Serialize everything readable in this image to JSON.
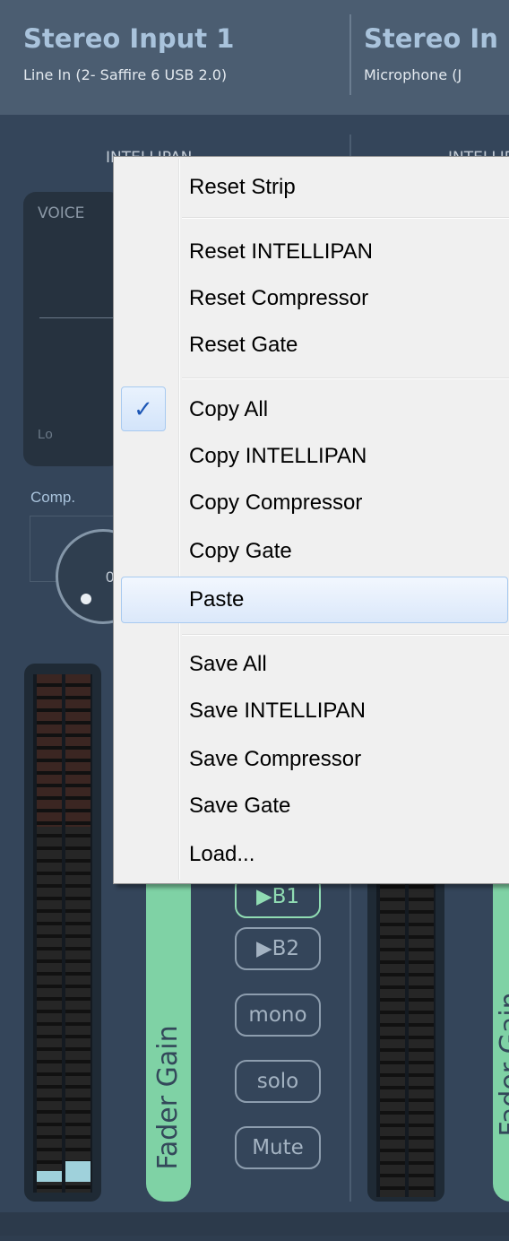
{
  "strips": [
    {
      "title": "Stereo Input 1",
      "subtitle": "Line In (2- Saffire 6 USB 2.0)"
    },
    {
      "title": "Stereo In",
      "subtitle": "Microphone (J"
    }
  ],
  "sections": {
    "intellipan_label": "INTELLIPAN",
    "voice_label": "VOICE",
    "lo_label": "Lo",
    "comp_label": "Comp.",
    "knob_value": "0"
  },
  "fader": {
    "label": "Fader Gain",
    "label2": "Fader Gain"
  },
  "strip_buttons": {
    "b1": "▶B1",
    "b2": "▶B2",
    "mono": "mono",
    "solo": "solo",
    "mute": "Mute"
  },
  "meter": {
    "level_left": 0.02,
    "level_right": 0.04
  },
  "context_menu": {
    "items": [
      {
        "label": "Reset Strip"
      },
      {
        "label": "Reset INTELLIPAN"
      },
      {
        "label": "Reset Compressor"
      },
      {
        "label": "Reset Gate"
      },
      {
        "label": "Copy All",
        "checked": true
      },
      {
        "label": "Copy INTELLIPAN"
      },
      {
        "label": "Copy Compressor"
      },
      {
        "label": "Copy Gate"
      },
      {
        "label": "Paste",
        "highlighted": true
      },
      {
        "label": "Save All"
      },
      {
        "label": "Save INTELLIPAN"
      },
      {
        "label": "Save Compressor"
      },
      {
        "label": "Save Gate"
      },
      {
        "label": "Load..."
      }
    ],
    "check_icon": "checkmark-icon"
  },
  "colors": {
    "header_bg": "#4b5d71",
    "title": "#a9c3dc",
    "fader_green": "#7fd2a5",
    "menu_bg": "#f0f0f0",
    "menu_highlight_border": "#a8caf0"
  }
}
